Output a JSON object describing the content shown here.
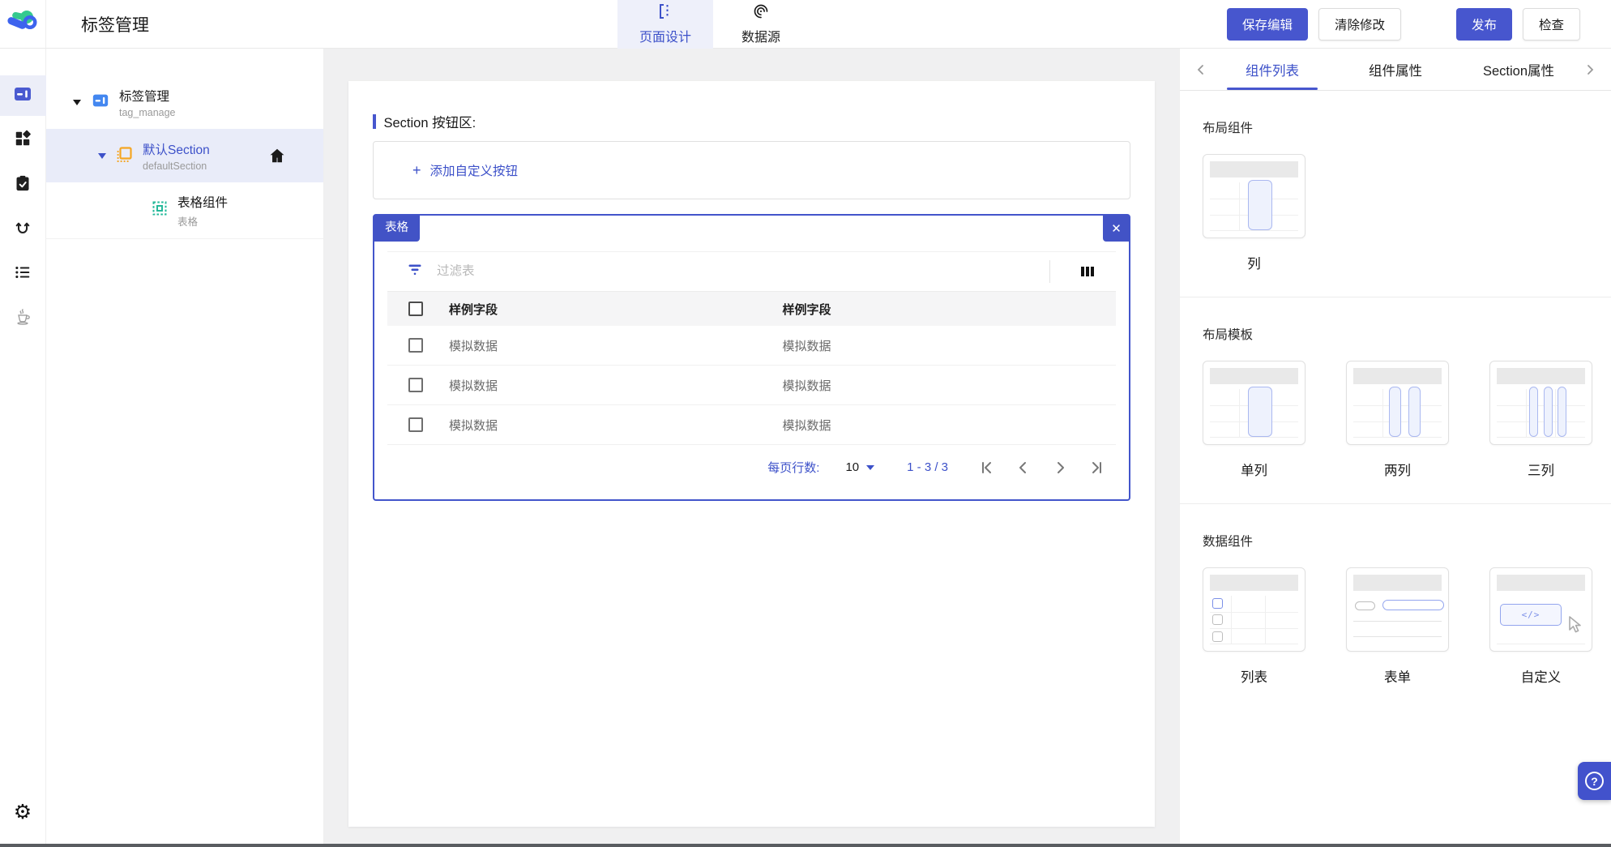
{
  "header": {
    "title": "标签管理",
    "tabs": [
      {
        "label": "页面设计",
        "active": true
      },
      {
        "label": "数据源",
        "active": false
      }
    ],
    "buttons": [
      {
        "label": "保存编辑",
        "style": "primary"
      },
      {
        "label": "清除修改",
        "style": "secondary"
      },
      {
        "label": "发布",
        "style": "primary"
      },
      {
        "label": "检查",
        "style": "secondary"
      }
    ]
  },
  "tree": {
    "items": [
      {
        "title": "标签管理",
        "subtitle": "tag_manage",
        "selected": false
      },
      {
        "title": "默认Section",
        "subtitle": "defaultSection",
        "selected": true
      },
      {
        "title": "表格组件",
        "subtitle": "表格",
        "selected": false
      }
    ]
  },
  "canvas": {
    "section_heading": "Section 按钮区:",
    "add_button_label": "添加自定义按钮",
    "widget_tag": "表格",
    "table": {
      "filter_placeholder": "过滤表",
      "columns": [
        "样例字段",
        "样例字段"
      ],
      "rows": [
        [
          "模拟数据",
          "模拟数据"
        ],
        [
          "模拟数据",
          "模拟数据"
        ],
        [
          "模拟数据",
          "模拟数据"
        ]
      ],
      "pagination": {
        "rows_per_page_label": "每页行数:",
        "rows_per_page_value": "10",
        "range_label": "1 - 3 / 3"
      }
    }
  },
  "inspector": {
    "tabs": [
      {
        "label": "组件列表",
        "active": true
      },
      {
        "label": "组件属性",
        "active": false
      },
      {
        "label": "Section属性",
        "active": false
      }
    ],
    "sections": [
      {
        "title": "布局组件",
        "items": [
          {
            "label": "列"
          }
        ]
      },
      {
        "title": "布局模板",
        "items": [
          {
            "label": "单列"
          },
          {
            "label": "两列"
          },
          {
            "label": "三列"
          }
        ]
      },
      {
        "title": "数据组件",
        "items": [
          {
            "label": "列表"
          },
          {
            "label": "表单"
          },
          {
            "label": "自定义"
          }
        ]
      }
    ]
  },
  "icons": {
    "plus": "+",
    "close": "✕",
    "help": "?",
    "code": "</>"
  },
  "colors": {
    "primary": "#4756ce",
    "accent_text": "#3d51c9",
    "tag_bg": "#4253c6",
    "selected_bg": "#e9ecf9"
  }
}
